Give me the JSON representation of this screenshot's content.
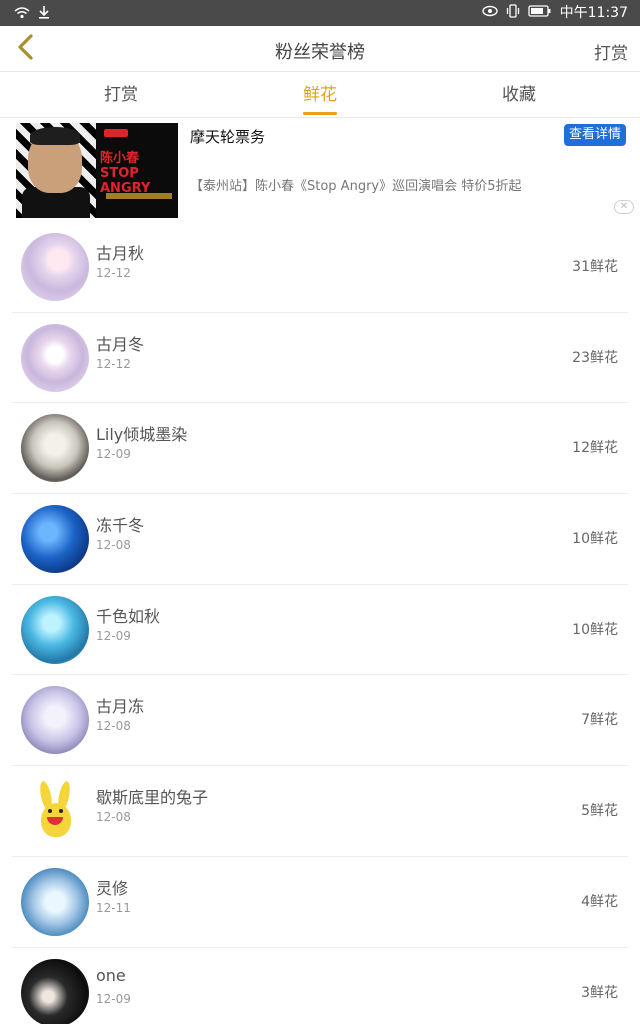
{
  "status_bar": {
    "time": "中午11:37"
  },
  "header": {
    "title": "粉丝荣誉榜",
    "reward_label": "打赏"
  },
  "tabs": [
    {
      "label": "打赏",
      "active": false
    },
    {
      "label": "鲜花",
      "active": true
    },
    {
      "label": "收藏",
      "active": false
    }
  ],
  "colors": {
    "accent": "#e6a117",
    "cta_blue": "#1e6fd9",
    "status_bar": "#4a4a4a"
  },
  "ad": {
    "advertiser": "摩天轮票务",
    "cta": "查看详情",
    "description": "【泰州站】陈小春《Stop Angry》巡回演唱会 特价5折起",
    "image_text": "陈小春 STOP ANGRY"
  },
  "fans": [
    {
      "name": "古月秋",
      "date": "12-12",
      "flowers": "31鲜花"
    },
    {
      "name": "古月冬",
      "date": "12-12",
      "flowers": "23鲜花"
    },
    {
      "name": "Lily倾城墨染",
      "date": "12-09",
      "flowers": "12鲜花"
    },
    {
      "name": "冻千冬",
      "date": "12-08",
      "flowers": "10鲜花"
    },
    {
      "name": "千色如秋",
      "date": "12-09",
      "flowers": "10鲜花"
    },
    {
      "name": "古月冻",
      "date": "12-08",
      "flowers": "7鲜花"
    },
    {
      "name": "歇斯底里的兔子",
      "date": "12-08",
      "flowers": "5鲜花"
    },
    {
      "name": "灵修",
      "date": "12-11",
      "flowers": "4鲜花"
    },
    {
      "name": "one",
      "date": "12-09",
      "flowers": "3鲜花"
    }
  ]
}
